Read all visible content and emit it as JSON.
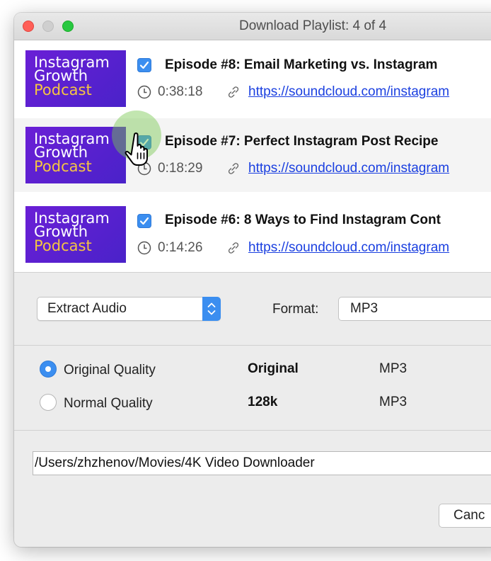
{
  "window": {
    "title": "Download Playlist: 4 of 4"
  },
  "episodes": [
    {
      "thumb_lines": [
        "Instagram",
        "Growth",
        "Podcast"
      ],
      "checked": true,
      "title": "Episode #8: Email Marketing vs. Instagram",
      "duration": "0:38:18",
      "url": "https://soundcloud.com/instagram"
    },
    {
      "thumb_lines": [
        "Instagram",
        "Growth",
        "Podcast"
      ],
      "checked": true,
      "title": "Episode #7: Perfect Instagram Post Recipe",
      "duration": "0:18:29",
      "url": "https://soundcloud.com/instagram"
    },
    {
      "thumb_lines": [
        "Instagram",
        "Growth",
        "Podcast"
      ],
      "checked": true,
      "title": "Episode #6: 8 Ways to Find Instagram Cont",
      "duration": "0:14:26",
      "url": "https://soundcloud.com/instagram"
    }
  ],
  "options": {
    "mode_selected": "Extract Audio",
    "format_label": "Format:",
    "format_value": "MP3"
  },
  "quality": [
    {
      "label": "Original Quality",
      "value": "Original",
      "format": "MP3",
      "selected": true
    },
    {
      "label": "Normal Quality",
      "value": "128k",
      "format": "MP3",
      "selected": false
    }
  ],
  "save_path": "/Users/zhzhenov/Movies/4K Video Downloader",
  "buttons": {
    "cancel": "Canc"
  },
  "colors": {
    "accent": "#3b8ef0",
    "link": "#1a3fe0",
    "thumb_bg": "#5b22d0",
    "thumb_highlight": "#f5c542"
  },
  "icons": {
    "clock": "clock-icon",
    "link": "link-icon",
    "check": "checkmark-icon",
    "cursor": "hand-pointer-icon"
  }
}
